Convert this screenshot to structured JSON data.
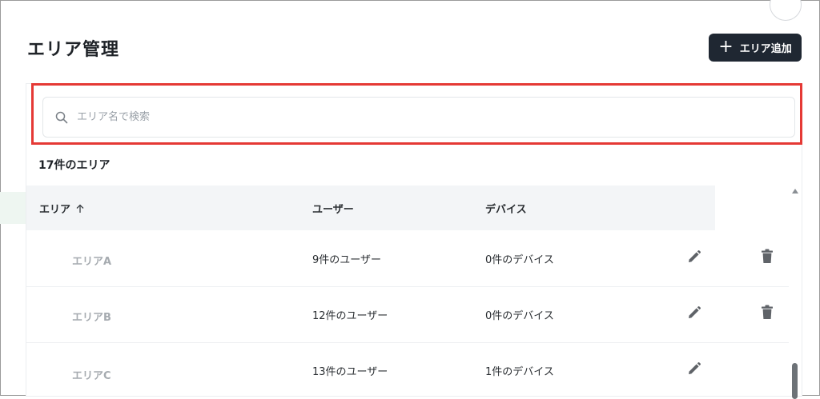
{
  "header": {
    "title": "エリア管理",
    "add_button_label": "エリア追加"
  },
  "search": {
    "placeholder": "エリア名で検索",
    "value": ""
  },
  "summary": {
    "count_label": "17件のエリア"
  },
  "table": {
    "columns": [
      {
        "label": "エリア",
        "sort": "ascending"
      },
      {
        "label": "ユーザー"
      },
      {
        "label": "デバイス"
      }
    ],
    "rows": [
      {
        "area": "エリアA",
        "users": "9件のユーザー",
        "devices": "0件のデバイス",
        "deletable": true
      },
      {
        "area": "エリアB",
        "users": "12件のユーザー",
        "devices": "0件のデバイス",
        "deletable": true
      },
      {
        "area": "エリアC",
        "users": "13件のユーザー",
        "devices": "1件のデバイス",
        "deletable": false
      }
    ]
  },
  "colors": {
    "accent_button": "#1f2732",
    "highlight": "#e53935",
    "icon": "#5f6368"
  },
  "icons": {
    "search": "search-icon",
    "sort": "arrow-up-icon",
    "edit": "pencil-icon",
    "delete": "trash-icon",
    "add": "plus-icon"
  }
}
